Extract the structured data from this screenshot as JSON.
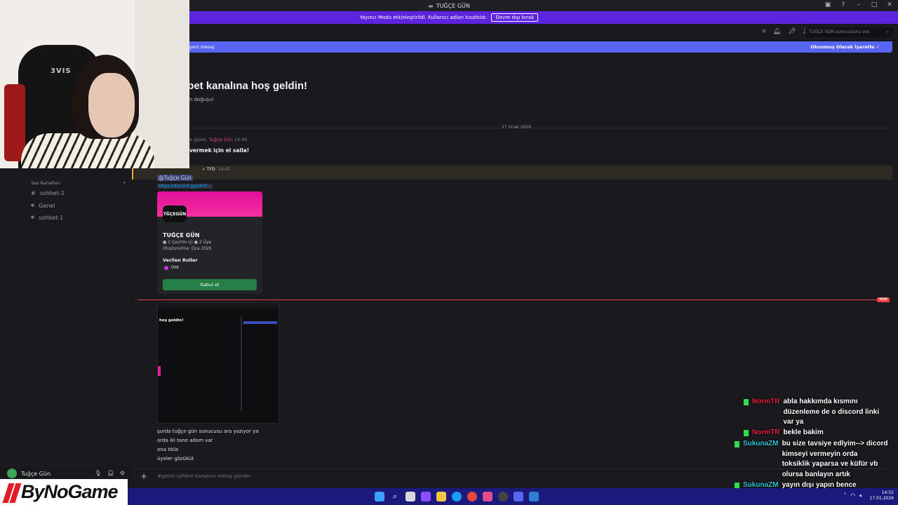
{
  "window": {
    "title": "TUĞÇE GÜN"
  },
  "banner": {
    "text": "Yayıncı Modu etkinleştirildi. Kullanıcı adları kısaltıldı.",
    "button": "Devre dışı bırak"
  },
  "header": {
    "search_placeholder": "TUĞÇE GÜN sunucusunu ara"
  },
  "new_messages": {
    "left": "yeni mesaj",
    "right": "Okunmuş Olarak İşaretle"
  },
  "sidebar": {
    "category": "Ses Kanalları",
    "channels": [
      {
        "icon": "#",
        "label": "sohbet-2"
      },
      {
        "icon": "🔊",
        "label": "Genel"
      },
      {
        "icon": "🔊",
        "label": "sohbet-1"
      }
    ],
    "user": "Tuğçe Gün"
  },
  "welcome": {
    "title": "hbet kanalına hoş geldin!",
    "subtitle": "ın doğuşu!"
  },
  "date_divider": "17 Ocak 2026",
  "system": {
    "line1_a": "e güzel, ",
    "line1_name": "Tuğçe Gün",
    "line1_time": "14:45",
    "line2": "vermek için el salla!"
  },
  "highlight": {
    "author": "✓ TFD",
    "time": "14:45",
    "mention": "@Tuğçe Gün",
    "link": "https://discord.gg/vR4T..."
  },
  "invite": {
    "icon_text": "TĞÇEGÜN",
    "name": "TUĞÇE GÜN",
    "stats": "● 2 Çevrim içi  ● 2 Üye",
    "created": "Oluşturulma: Oca 2026",
    "roles_label": "Verilen Roller",
    "role": "ÜYE",
    "accept": "Kabul et"
  },
  "new_tag": "YENİ",
  "screenshot_text": "hoş geldin!",
  "messages": [
    "şurda tuğçe gün sunucusu ara yazıyor ya",
    "orda iki tane adam var",
    "ona tıkla",
    "üyeler gözüküt"
  ],
  "composer": {
    "placeholder": "#genel-sohbet kanalına mesaj gönder"
  },
  "overlay_chat": [
    {
      "user": "NormTR",
      "color": "#e0243c",
      "lines": [
        "abla hakkımda kısmını",
        "düzenleme de o discord linki",
        "var ya"
      ]
    },
    {
      "user": "NormTR",
      "color": "#e0243c",
      "lines": [
        "bekle bakim"
      ]
    },
    {
      "user": "SukunaZM",
      "color": "#31c2d8",
      "lines": [
        "bu size tavsiye edlyim--> dicord",
        "kimseyi vermeyin orda",
        "toksiklik yaparsa ve küfür vb",
        "olursa banlayın artık"
      ]
    },
    {
      "user": "SukunaZM",
      "color": "#31c2d8",
      "lines": [
        "yayın dışı yapın bence"
      ]
    }
  ],
  "clock": {
    "time": "14:52",
    "date": "17.01.2026"
  },
  "brand": "ByNoGame",
  "webcam_logo": "3VIS"
}
